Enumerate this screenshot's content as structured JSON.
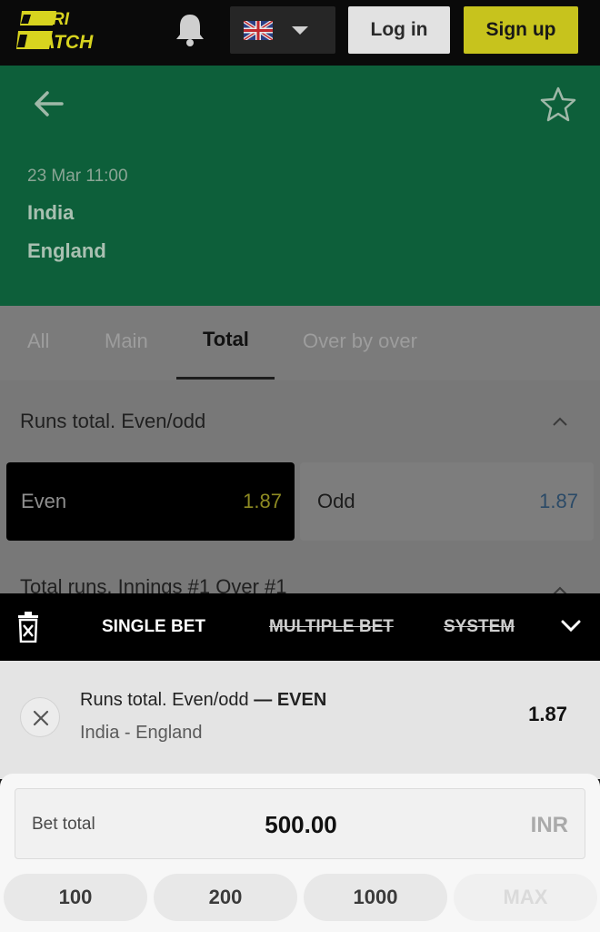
{
  "header": {
    "logo_text": "PARI MATCH",
    "login_label": "Log in",
    "signup_label": "Sign up",
    "language_flag": "uk-flag-icon"
  },
  "event": {
    "date": "23 Mar 11:00",
    "team1": "India",
    "team2": "England"
  },
  "tabs": [
    {
      "label": "All",
      "active": false
    },
    {
      "label": "Main",
      "active": false
    },
    {
      "label": "Total",
      "active": true
    },
    {
      "label": "Over by over",
      "active": false
    }
  ],
  "markets": [
    {
      "title": "Runs total. Even/odd",
      "outcomes": [
        {
          "label": "Even",
          "odds": "1.87",
          "selected": true
        },
        {
          "label": "Odd",
          "odds": "1.87",
          "selected": false
        }
      ]
    },
    {
      "title": "Total runs. Innings #1 Over #1"
    }
  ],
  "betslip": {
    "tabs": [
      {
        "label": "SINGLE BET",
        "enabled": true
      },
      {
        "label": "MULTIPLE BET",
        "enabled": false
      },
      {
        "label": "SYSTEM",
        "enabled": false
      }
    ],
    "bet": {
      "market": "Runs total. Even/odd",
      "separator": " — ",
      "selection": "EVEN",
      "event": "India - England",
      "odds": "1.87"
    },
    "stake": {
      "label": "Bet total",
      "value": "500.00",
      "currency": "INR"
    },
    "quick_amounts": [
      "100",
      "200",
      "1000",
      "MAX"
    ]
  },
  "colors": {
    "brand_yellow": "#d8d41f",
    "hero_green": "#0d5f3a",
    "topbar": "#0a0a0a"
  }
}
